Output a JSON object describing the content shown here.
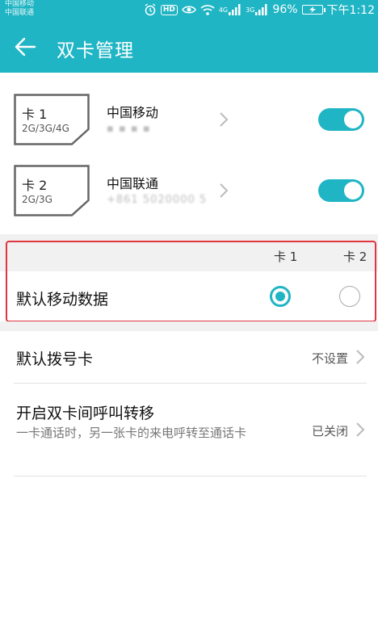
{
  "status_bar": {
    "carrier_1": "中国移动",
    "carrier_2": "中国联通",
    "hd": "HD",
    "net_1": "4G",
    "net_2": "3G",
    "battery": "96%",
    "time": "下午1:12"
  },
  "header": {
    "title": "双卡管理"
  },
  "sims": [
    {
      "card": "卡 1",
      "network": "2G/3G/4G",
      "carrier": "中国移动",
      "number": "▪ ▪ ▪ ▪",
      "enabled": true
    },
    {
      "card": "卡 2",
      "network": "2G/3G",
      "carrier": "中国联通",
      "number": "+861 5020000 5",
      "enabled": true
    }
  ],
  "default_data": {
    "col_1": "卡 1",
    "col_2": "卡 2",
    "label": "默认移动数据",
    "selected": "卡 1"
  },
  "settings": [
    {
      "label": "默认拨号卡",
      "value": "不设置"
    },
    {
      "label": "开启双卡间呼叫转移",
      "description": "一卡通话时，另一张卡的来电呼转至通话卡",
      "value": "已关闭"
    }
  ],
  "colors": {
    "accent": "#20b5c4",
    "highlight_border": "#e0363f"
  }
}
